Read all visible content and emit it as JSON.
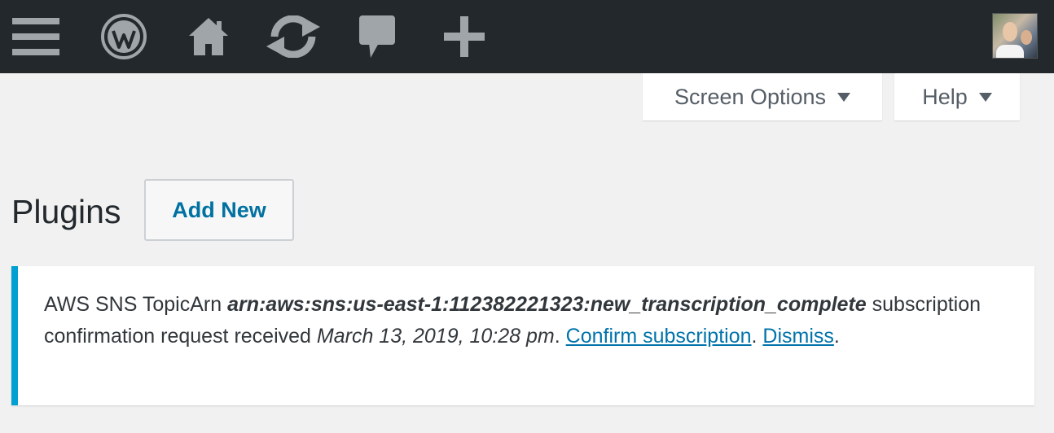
{
  "admin_bar": {
    "icons": [
      "menu-icon",
      "wordpress-logo-icon",
      "home-icon",
      "updates-icon",
      "comments-icon",
      "add-new-icon"
    ],
    "colors": {
      "background": "#23282d",
      "icon": "#a0a5aa"
    }
  },
  "screen_meta": {
    "screen_options_label": "Screen Options",
    "help_label": "Help"
  },
  "page": {
    "title": "Plugins",
    "add_new_label": "Add New"
  },
  "notice": {
    "prefix": "AWS SNS TopicArn ",
    "topic_arn": "arn:aws:sns:us-east-1:112382221323:new_transcription_complete",
    "middle": " subscription confirmation request received ",
    "received_at": "March 13, 2019, 10:28 pm",
    "sep1": ". ",
    "confirm_label": "Confirm subscription",
    "sep2": ". ",
    "dismiss_label": "Dismiss",
    "end": ".",
    "accent_color": "#00a0d2"
  }
}
